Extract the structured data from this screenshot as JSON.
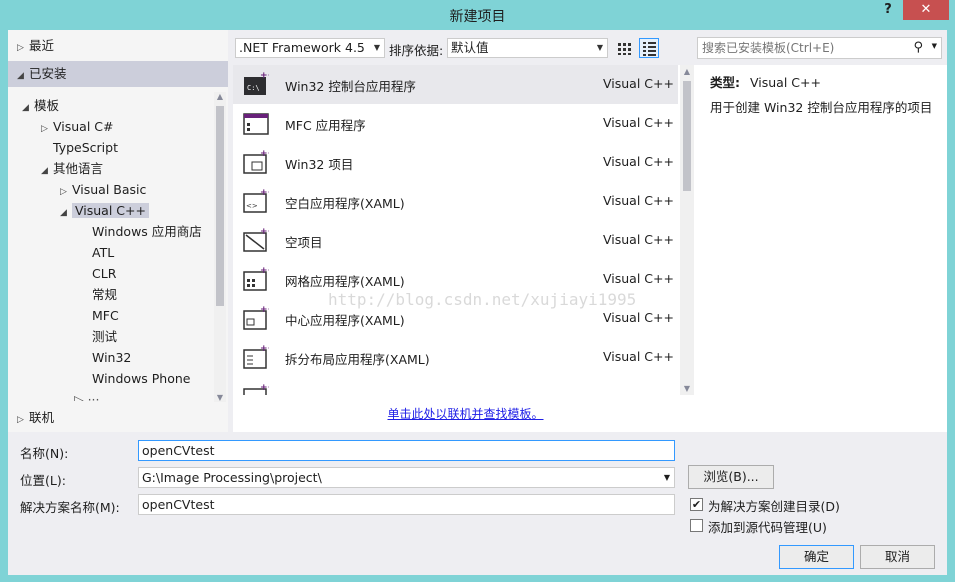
{
  "window": {
    "title": "新建项目",
    "help": "?",
    "close": "✕"
  },
  "left": {
    "recent": "最近",
    "installed": "已安装",
    "tree": [
      {
        "label": "模板",
        "arrow": "◢"
      },
      {
        "label": "Visual C#",
        "arrow": "▷"
      },
      {
        "label": "TypeScript",
        "arrow": ""
      },
      {
        "label": "其他语言",
        "arrow": "◢"
      },
      {
        "label": "Visual Basic",
        "arrow": "▷"
      },
      {
        "label": "Visual C++",
        "arrow": "◢"
      },
      {
        "label": "Windows 应用商店",
        "arrow": ""
      },
      {
        "label": "ATL",
        "arrow": ""
      },
      {
        "label": "CLR",
        "arrow": ""
      },
      {
        "label": "常规",
        "arrow": ""
      },
      {
        "label": "MFC",
        "arrow": ""
      },
      {
        "label": "测试",
        "arrow": ""
      },
      {
        "label": "Win32",
        "arrow": ""
      },
      {
        "label": "Windows Phone",
        "arrow": ""
      }
    ],
    "online": "联机"
  },
  "toolbar": {
    "framework": ".NET Framework 4.5",
    "sort_label": "排序依据:",
    "sort_value": "默认值"
  },
  "search": {
    "placeholder": "搜索已安装模板(Ctrl+E)"
  },
  "templates": [
    {
      "name": "Win32 控制台应用程序",
      "lang": "Visual C++",
      "icon": "console-icon"
    },
    {
      "name": "MFC 应用程序",
      "lang": "Visual C++",
      "icon": "mfc-icon"
    },
    {
      "name": "Win32 项目",
      "lang": "Visual C++",
      "icon": "win32-icon"
    },
    {
      "name": "空白应用程序(XAML)",
      "lang": "Visual C++",
      "icon": "blank-xaml-icon"
    },
    {
      "name": "空项目",
      "lang": "Visual C++",
      "icon": "empty-project-icon"
    },
    {
      "name": "网格应用程序(XAML)",
      "lang": "Visual C++",
      "icon": "grid-xaml-icon"
    },
    {
      "name": "中心应用程序(XAML)",
      "lang": "Visual C++",
      "icon": "hub-xaml-icon"
    },
    {
      "name": "拆分布局应用程序(XAML)",
      "lang": "Visual C++",
      "icon": "split-xaml-icon"
    }
  ],
  "online_link": "单击此处以联机并查找模板。",
  "watermark": "http://blog.csdn.net/xujiayi1995",
  "details": {
    "type_label": "类型:",
    "type_value": "Visual C++",
    "description": "用于创建 Win32 控制台应用程序的项目"
  },
  "form": {
    "name_label": "名称(N):",
    "name_value": "openCVtest",
    "location_label": "位置(L):",
    "location_value": "G:\\Image Processing\\project\\",
    "browse": "浏览(B)...",
    "solution_label": "解决方案名称(M):",
    "solution_value": "openCVtest",
    "create_dir": "为解决方案创建目录(D)",
    "create_dir_checked": true,
    "source_control": "添加到源代码管理(U)",
    "source_control_checked": false,
    "ok": "确定",
    "cancel": "取消"
  },
  "colors": {
    "accent": "#3399ff",
    "chrome": "#7fd3d6",
    "close": "#c75050",
    "template_icon_plus": "#68217a"
  }
}
